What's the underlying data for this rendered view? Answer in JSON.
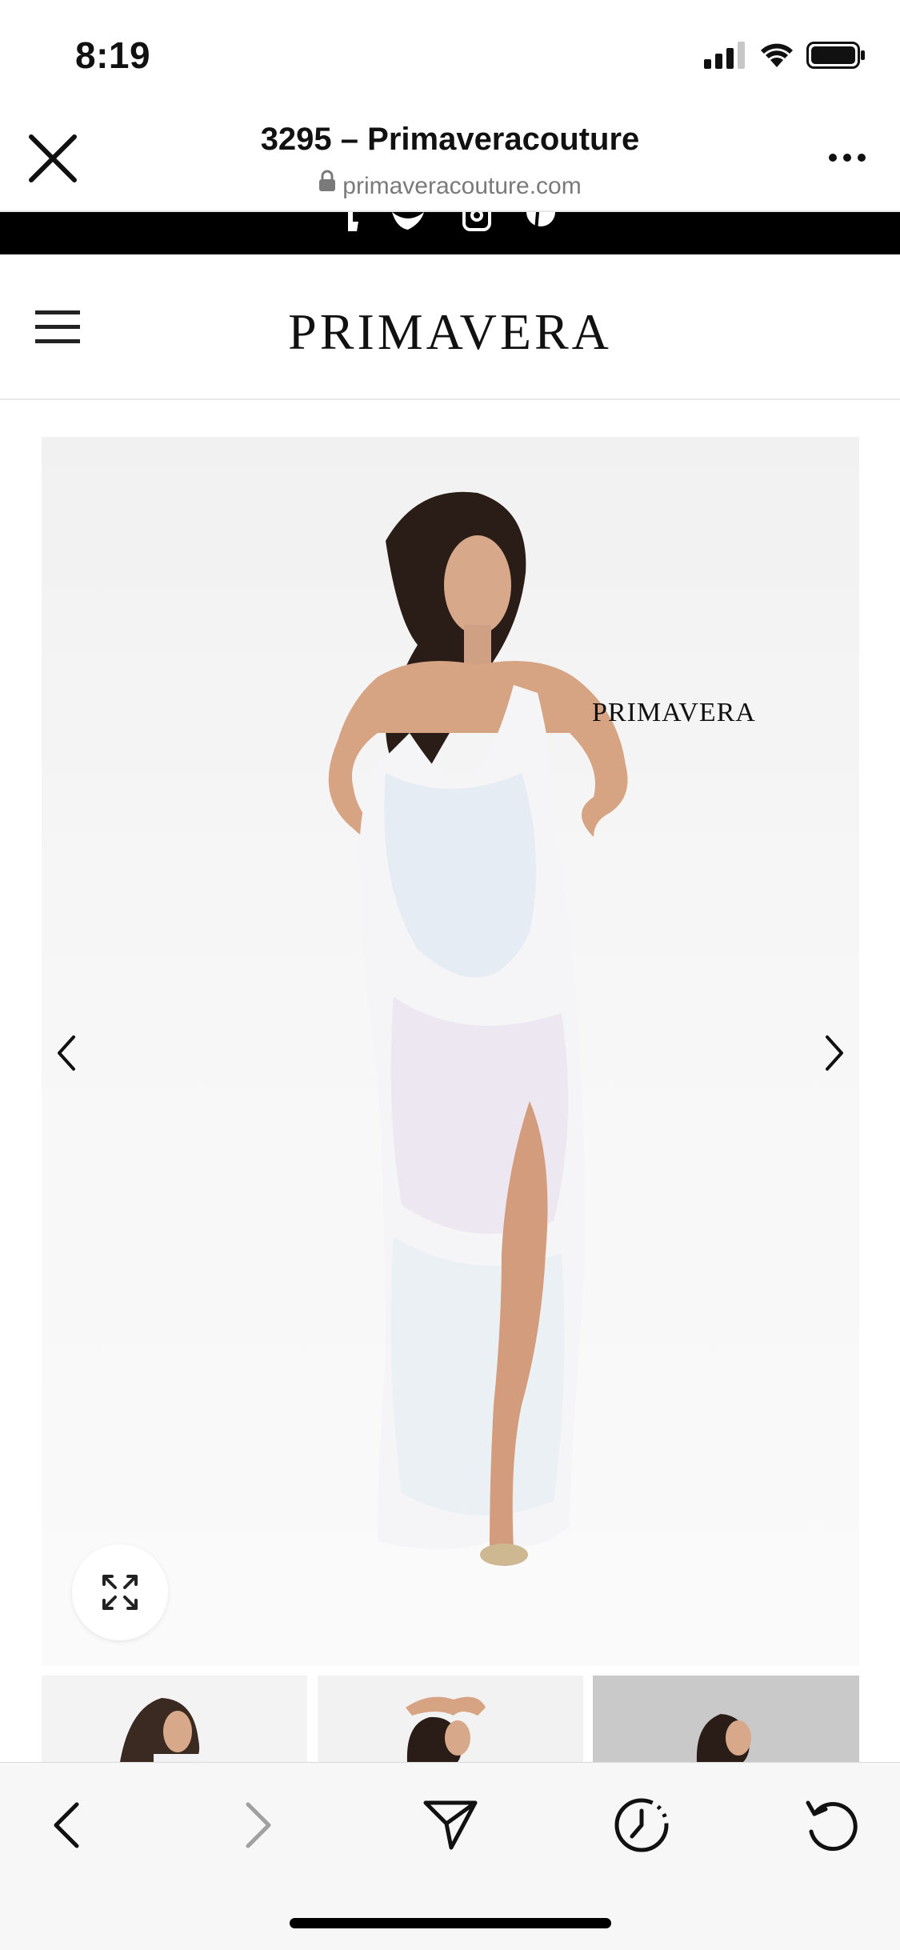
{
  "status_bar": {
    "time": "8:19"
  },
  "browser": {
    "title": "3295 – Primaveracouture",
    "url": "primaveracouture.com"
  },
  "site": {
    "logo_text": "PRIMAVERA",
    "social_icons": [
      "facebook-icon",
      "twitter-icon",
      "instagram-icon",
      "pinterest-icon"
    ]
  },
  "product_gallery": {
    "image_brand_text": "PRIMAVERA",
    "thumbnails": [
      "thumbnail-1",
      "thumbnail-2",
      "thumbnail-3"
    ]
  },
  "toolbar": {
    "icons": [
      "back-icon",
      "forward-icon",
      "share-icon",
      "history-icon",
      "reload-icon"
    ]
  },
  "colors": {
    "black_bar": "#000000",
    "url_gray": "#7a7a7a",
    "toolbar_bg": "#f7f7f7",
    "forward_disabled": "#a0a0a0"
  }
}
